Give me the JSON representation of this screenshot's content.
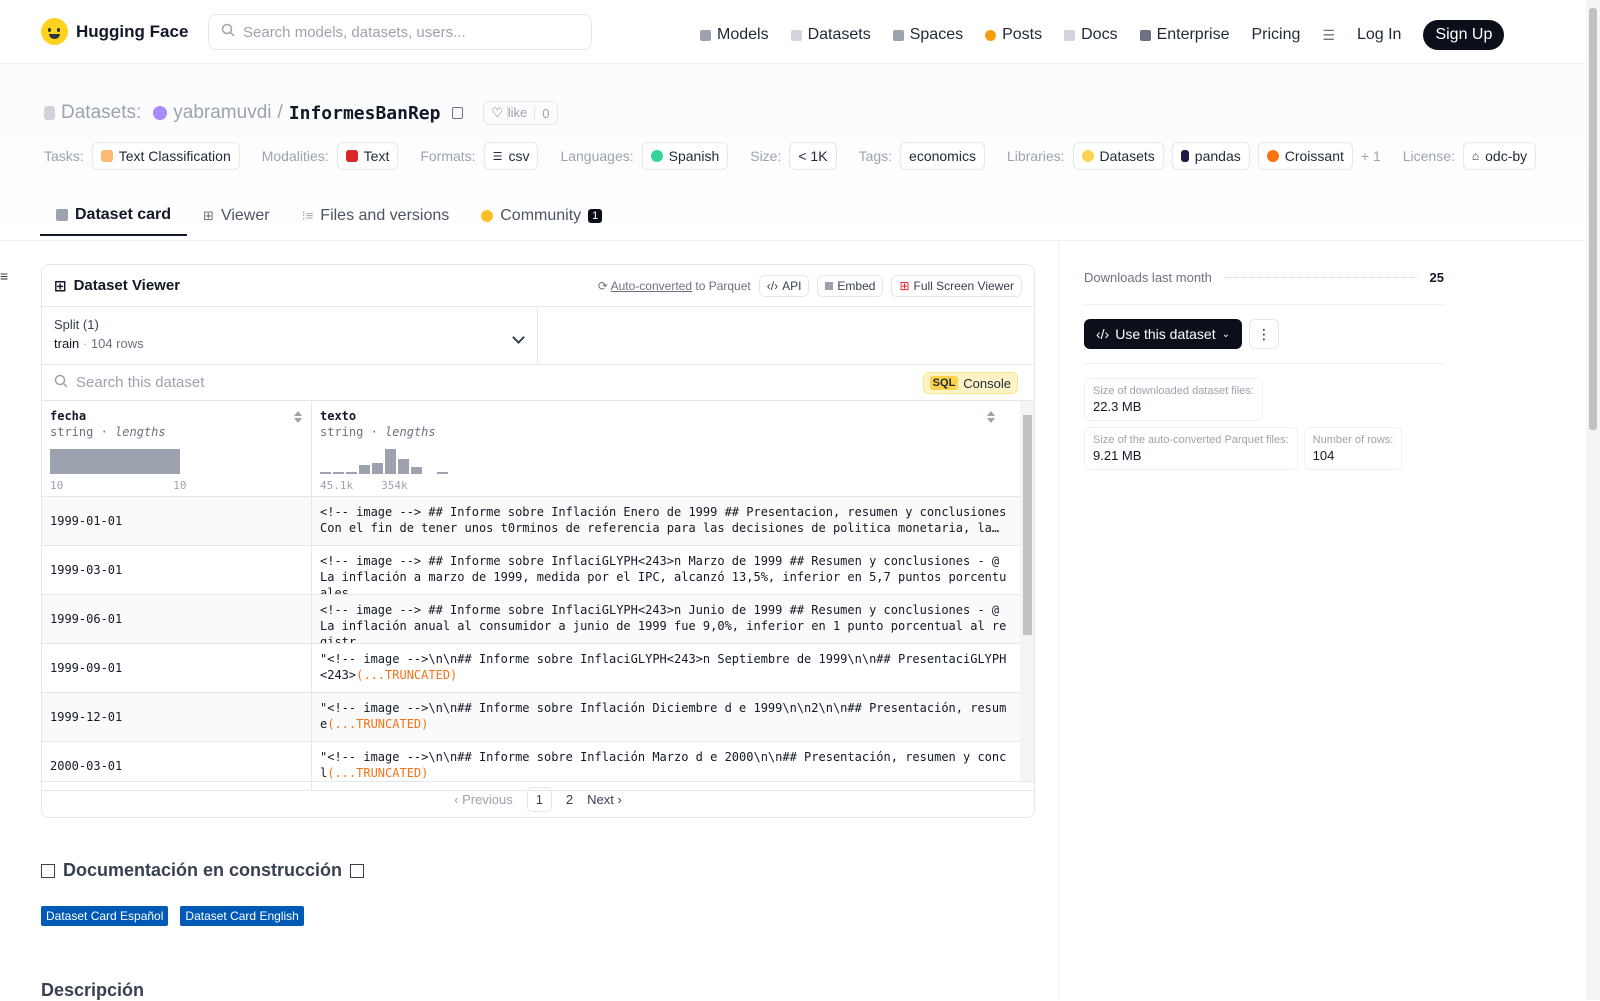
{
  "header": {
    "brand": "Hugging Face",
    "search_placeholder": "Search models, datasets, users...",
    "nav": [
      {
        "label": "Models",
        "color": "#9ca3af"
      },
      {
        "label": "Datasets",
        "color": "#d1d5db"
      },
      {
        "label": "Spaces",
        "color": "#9ca3af"
      },
      {
        "label": "Posts",
        "color": "#f59e0b"
      },
      {
        "label": "Docs",
        "color": "#d1d5db"
      },
      {
        "label": "Enterprise",
        "color": "#6b7280"
      }
    ],
    "pricing": "Pricing",
    "login": "Log In",
    "signup": "Sign Up"
  },
  "repo": {
    "section": "Datasets:",
    "owner": "yabramuvdi",
    "name": "InformesBanRep",
    "like_label": "like",
    "like_count": "0"
  },
  "tags": {
    "tasks_label": "Tasks:",
    "task": "Text Classification",
    "modalities_label": "Modalities:",
    "modality": "Text",
    "formats_label": "Formats:",
    "format": "csv",
    "languages_label": "Languages:",
    "language": "Spanish",
    "size_label": "Size:",
    "size": "< 1K",
    "tags_label": "Tags:",
    "tag": "economics",
    "libraries_label": "Libraries:",
    "libs": [
      "Datasets",
      "pandas",
      "Croissant"
    ],
    "more_libs": "+ 1",
    "license_label": "License:",
    "license": "odc-by"
  },
  "tabs": [
    {
      "label": "Dataset card"
    },
    {
      "label": "Viewer"
    },
    {
      "label": "Files and versions"
    },
    {
      "label": "Community",
      "badge": "1"
    }
  ],
  "viewer": {
    "title": "Dataset Viewer",
    "auto_converted": "Auto-converted",
    "to_parquet": "to Parquet",
    "api": "API",
    "embed": "Embed",
    "fullscreen": "Full Screen Viewer",
    "split_label": "Split (1)",
    "split_value": "train",
    "split_rows": "104 rows",
    "search_placeholder": "Search this dataset",
    "sql_tag": "SQL",
    "sql_console": "Console",
    "columns": [
      {
        "name": "fecha",
        "type": "string",
        "stat": "lengths",
        "min": "10",
        "max": "10"
      },
      {
        "name": "texto",
        "type": "string",
        "stat": "lengths",
        "min": "45.1k",
        "max": "354k"
      }
    ],
    "texto_histogram": [
      0.1,
      0.05,
      0.08,
      0.35,
      0.45,
      1.0,
      0.6,
      0.3,
      0,
      0.05
    ],
    "rows": [
      {
        "fecha": "1999-01-01",
        "texto": "<!-- image --> ## Informe sobre Inflación Enero de 1999 ## Presentacion, resumen y conclusiones Con el fin de tener unos t0rminos de referencia para las decisiones de politica monetaria, la…",
        "trunc": ""
      },
      {
        "fecha": "1999-03-01",
        "texto": "<!-- image --> ## Informe sobre InflaciGLYPH<243>n Marzo de 1999 ## Resumen y conclusiones - @ La inflación a marzo de 1999, medida por el IPC, alcanzó 13,5%, inferior en 5,7 puntos porcentuales …",
        "trunc": ""
      },
      {
        "fecha": "1999-06-01",
        "texto": "<!-- image --> ## Informe sobre InflaciGLYPH<243>n Junio de 1999 ## Resumen y conclusiones - @ La inflación anual al consumidor a junio de 1999 fue 9,0%, inferior en 1 punto porcentual al registr…",
        "trunc": ""
      },
      {
        "fecha": "1999-09-01",
        "texto": "\"<!-- image -->\\n\\n## Informe sobre InflaciGLYPH<243>n Septiembre de 1999\\n\\n## PresentaciGLYPH<243>",
        "trunc": "(...TRUNCATED)"
      },
      {
        "fecha": "1999-12-01",
        "texto": "\"<!-- image -->\\n\\n## Informe sobre Inflación Diciembre d e 1999\\n\\n2\\n\\n## Presentación, resume",
        "trunc": "(...TRUNCATED)"
      },
      {
        "fecha": "2000-03-01",
        "texto": "\"<!-- image -->\\n\\n## Informe sobre Inflación Marzo d e 2000\\n\\n## Presentación, resumen y concl",
        "trunc": "(...TRUNCATED)"
      }
    ],
    "pager": {
      "prev": "Previous",
      "pages": [
        "1",
        "2"
      ],
      "next": "Next"
    }
  },
  "card": {
    "title": "Documentación en construcción",
    "badge_es": "Dataset Card Español",
    "badge_en": "Dataset Card English",
    "section": "Descripción"
  },
  "sidebar": {
    "downloads_label": "Downloads last month",
    "downloads_value": "25",
    "use_button": "Use this dataset",
    "stats": [
      {
        "k": "Size of downloaded dataset files:",
        "v": "22.3 MB"
      },
      {
        "k": "Size of the auto-converted Parquet files:",
        "v": "9.21 MB"
      },
      {
        "k": "Number of rows:",
        "v": "104"
      }
    ]
  }
}
